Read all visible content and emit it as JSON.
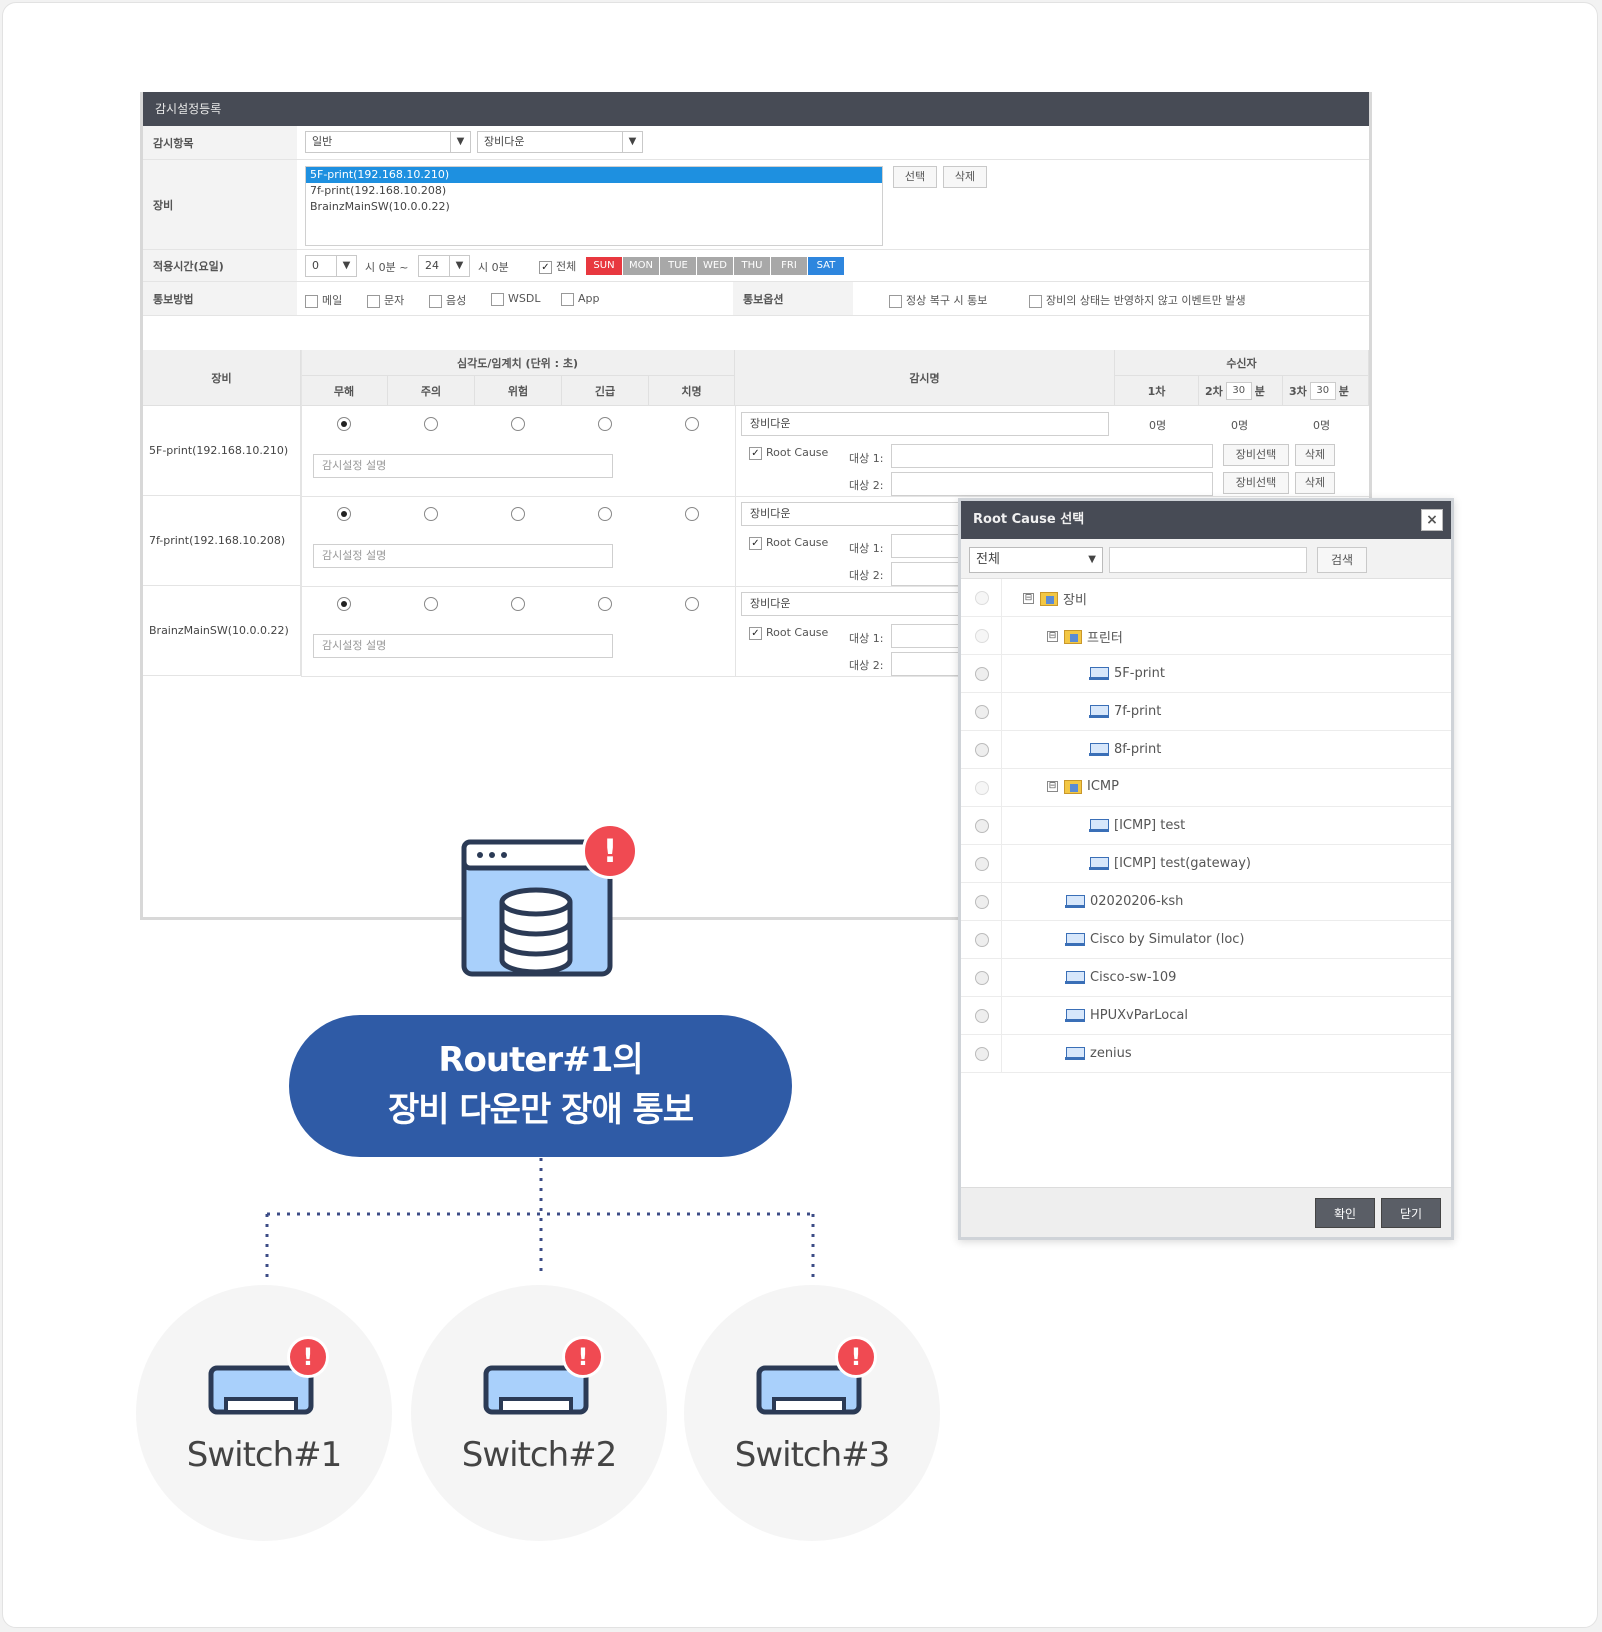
{
  "window": {
    "title": "감시설정등록",
    "fields": {
      "monitor_item_label": "감시항목",
      "monitor_type": "일반",
      "monitor_kind": "장비다운",
      "device_label": "장비",
      "devices": [
        "5F-print(192.168.10.210)",
        "7f-print(192.168.10.208)",
        "BrainzMainSW(10.0.0.22)"
      ],
      "select_btn": "선택",
      "delete_btn": "삭제",
      "time_label": "적용시간(요일)",
      "start_hour": "0",
      "start_suffix": "시 0분 ~",
      "end_hour": "24",
      "end_suffix": "시 0분",
      "all_label": "전체",
      "days": [
        {
          "label": "SUN",
          "color": "#e8383f"
        },
        {
          "label": "MON",
          "color": "#a8a8a8"
        },
        {
          "label": "TUE",
          "color": "#a8a8a8"
        },
        {
          "label": "WED",
          "color": "#a8a8a8"
        },
        {
          "label": "THU",
          "color": "#a8a8a8"
        },
        {
          "label": "FRI",
          "color": "#a8a8a8"
        },
        {
          "label": "SAT",
          "color": "#2e86de"
        }
      ],
      "notify_label": "통보방법",
      "notify_methods": [
        "메일",
        "문자",
        "음성",
        "WSDL",
        "App"
      ],
      "notify_option_label": "통보옵션",
      "notify_options": [
        "정상 복구 시 통보",
        "장비의 상태는 반영하지 않고 이벤트만 발생"
      ]
    },
    "table": {
      "device_header": "장비",
      "severity_header": "심각도/임계치 (단위 : 초)",
      "severity_levels": [
        "무해",
        "주의",
        "위험",
        "긴급",
        "치명"
      ],
      "monitor_name_header": "감시명",
      "recipient_header": "수신자",
      "recipient_1": "1차",
      "recipient_2": "2차",
      "recipient_2_value": "30",
      "recipient_3": "3차",
      "recipient_3_value": "30",
      "minute_unit": "분",
      "desc_placeholder": "감시설정 설명",
      "monitor_name_value": "장비다운",
      "root_cause_label": "Root Cause",
      "target1": "대상 1:",
      "target2": "대상 2:",
      "count_value": "0명",
      "device_select_btn": "장비선택",
      "row_delete_btn": "삭제",
      "rows": [
        "5F-print(192.168.10.210)",
        "7f-print(192.168.10.208)",
        "BrainzMainSW(10.0.0.22)"
      ]
    }
  },
  "popup": {
    "title": "Root Cause 선택",
    "close_icon": "×",
    "filter_value": "전체",
    "search_btn": "검색",
    "tree": [
      {
        "label": "장비",
        "type": "folder",
        "toggle": "⊟"
      },
      {
        "label": "프린터",
        "type": "folder",
        "toggle": "⊟"
      },
      {
        "label": "5F-print",
        "type": "device"
      },
      {
        "label": "7f-print",
        "type": "device"
      },
      {
        "label": "8f-print",
        "type": "device"
      },
      {
        "label": "ICMP",
        "type": "folder",
        "toggle": "⊟"
      },
      {
        "label": "[ICMP] test",
        "type": "device"
      },
      {
        "label": "[ICMP] test(gateway)",
        "type": "device"
      },
      {
        "label": "02020206-ksh",
        "type": "device"
      },
      {
        "label": "Cisco by Simulator (loc)",
        "type": "device"
      },
      {
        "label": "Cisco-sw-109",
        "type": "device"
      },
      {
        "label": "HPUXvParLocal",
        "type": "device"
      },
      {
        "label": "zenius",
        "type": "device"
      }
    ],
    "ok_btn": "확인",
    "close_btn": "닫기"
  },
  "diagram": {
    "router_line1": "Router#1의",
    "router_line2": "장비 다운만 장애 통보",
    "alert_symbol": "!",
    "switches": [
      "Switch#1",
      "Switch#2",
      "Switch#3"
    ],
    "colors": {
      "accent": "#2f5ba6",
      "alert": "#f04a52",
      "icon_fill": "#a9d0fb",
      "icon_stroke": "#2b3a55"
    }
  }
}
